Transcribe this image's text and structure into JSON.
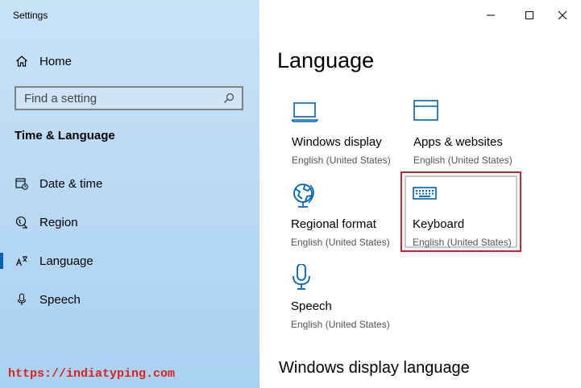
{
  "window": {
    "title": "Settings",
    "controls": [
      "minimize",
      "maximize",
      "close"
    ]
  },
  "sidebar": {
    "home_label": "Home",
    "search_placeholder": "Find a setting",
    "section_title": "Time & Language",
    "items": [
      {
        "label": "Date & time",
        "icon": "calendar-clock-icon"
      },
      {
        "label": "Region",
        "icon": "globe-region-icon"
      },
      {
        "label": "Language",
        "icon": "language-icon",
        "active": true
      },
      {
        "label": "Speech",
        "icon": "microphone-icon"
      }
    ]
  },
  "main": {
    "title": "Language",
    "tiles": [
      {
        "name": "Windows display",
        "sub": "English (United States)",
        "icon": "monitor-icon"
      },
      {
        "name": "Apps & websites",
        "sub": "English (United States)",
        "icon": "window-icon"
      },
      {
        "name": "Regional format",
        "sub": "English (United States)",
        "icon": "globe-icon"
      },
      {
        "name": "Keyboard",
        "sub": "English (United States)",
        "icon": "keyboard-icon"
      },
      {
        "name": "Speech",
        "sub": "English (United States)",
        "icon": "microphone-icon"
      }
    ],
    "subheading": "Windows display language"
  },
  "watermark": "https://indiatyping.com",
  "colors": {
    "accent": "#0063b1",
    "highlight": "#cc2233",
    "watermark": "#e02020"
  }
}
